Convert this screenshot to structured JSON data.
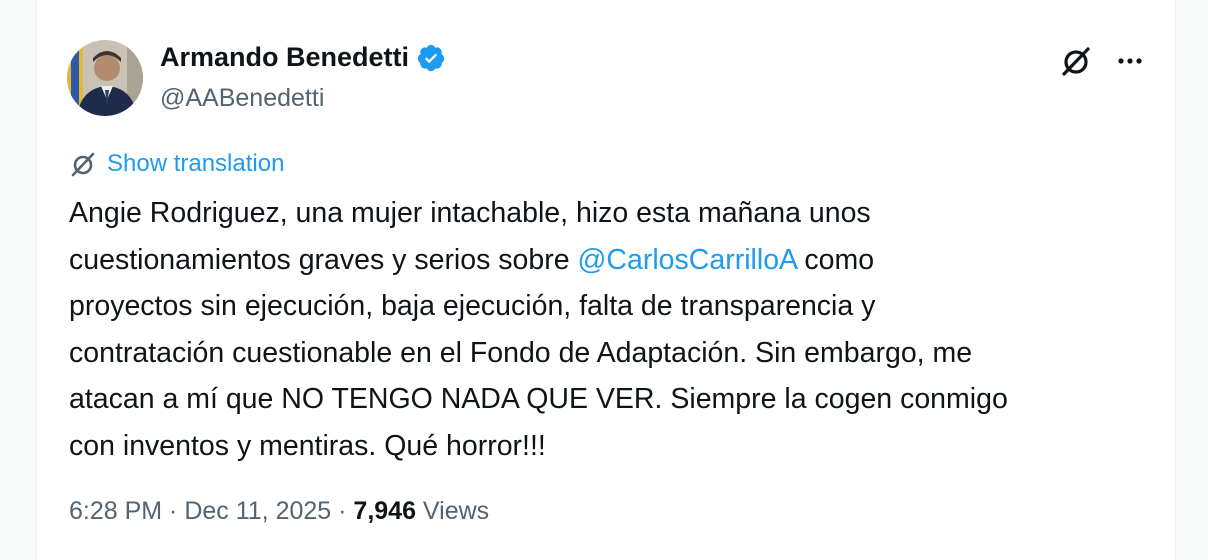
{
  "author": {
    "display_name": "Armando Benedetti",
    "handle": "@AABenedetti",
    "verified": true
  },
  "translation": {
    "label": "Show translation"
  },
  "tweet": {
    "line_1": "Angie Rodriguez, una mujer intachable, hizo esta mañana unos",
    "line_2_before": "cuestionamientos graves y serios sobre ",
    "mention": "@CarlosCarrilloA",
    "line_2_after": " como",
    "line_3": "proyectos sin ejecución, baja ejecución, falta de transparencia y",
    "line_4": "contratación cuestionable en el Fondo de Adaptación. Sin embargo, me",
    "line_5": "atacan a mí que NO TENGO NADA QUE VER. Siempre la cogen conmigo",
    "line_6": "con inventos y mentiras. Qué horror!!!"
  },
  "meta": {
    "time": "6:28 PM",
    "separator": " · ",
    "date": "Dec 11, 2025",
    "views_count": "7,946",
    "views_label": " Views"
  },
  "icons": {
    "verified": "verified-badge-icon",
    "grok": "grok-icon",
    "more": "more-options-icon",
    "translate": "translate-icon"
  },
  "colors": {
    "accent": "#1d9bf0",
    "text": "#0f1419",
    "secondary": "#536471"
  }
}
